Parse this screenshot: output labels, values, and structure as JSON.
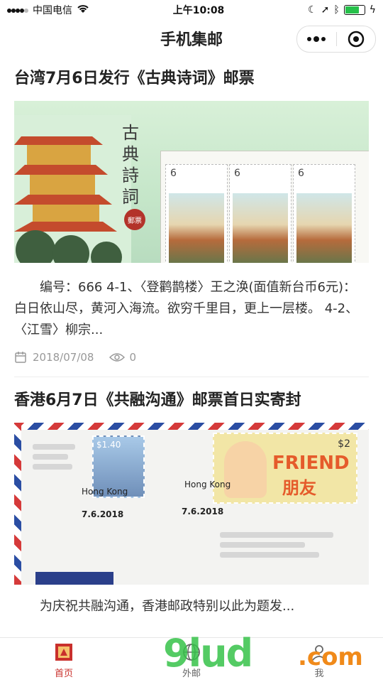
{
  "status_bar": {
    "carrier": "中国电信",
    "time": "上午10:08"
  },
  "navbar": {
    "title": "手机集邮"
  },
  "articles": [
    {
      "title": "台湾7月6日发行《古典诗词》邮票",
      "image_text": {
        "calligraphy": "古典詩詞",
        "seal": "郵票",
        "denomination": "6"
      },
      "summary": "编号：666 4-1、〈登鹳鹊楼〉王之涣(面值新台币6元)： 白日依山尽，黄河入海流。欲穷千里目，更上一层楼。 4-2、〈江雪〉柳宗...",
      "date": "2018/07/08",
      "views": "0"
    },
    {
      "title": "香港6月7日《共融沟通》邮票首日实寄封",
      "image_text": {
        "stamp1_value": "$1.40",
        "stamp2_value": "$2",
        "stamp2_text": "FRIEND",
        "stamp2_text_cn": "朋友",
        "postmark1_place": "Hong Kong",
        "postmark1_date": "7.6.2018",
        "postmark2_place": "Hong Kong",
        "postmark2_date": "7.6.2018"
      },
      "summary": "为庆祝共融沟通，香港邮政特别以此为题发..."
    }
  ],
  "tabbar": {
    "tabs": [
      {
        "label": "首页",
        "icon": "stamp-home-icon",
        "active": true
      },
      {
        "label": "外邮",
        "icon": "globe-icon",
        "active": false
      },
      {
        "label": "我",
        "icon": "user-icon",
        "active": false
      }
    ]
  },
  "watermark": {
    "text": "9lud",
    "suffix": ".com"
  },
  "colors": {
    "accent": "#c9302c",
    "battery": "#26c04a"
  }
}
